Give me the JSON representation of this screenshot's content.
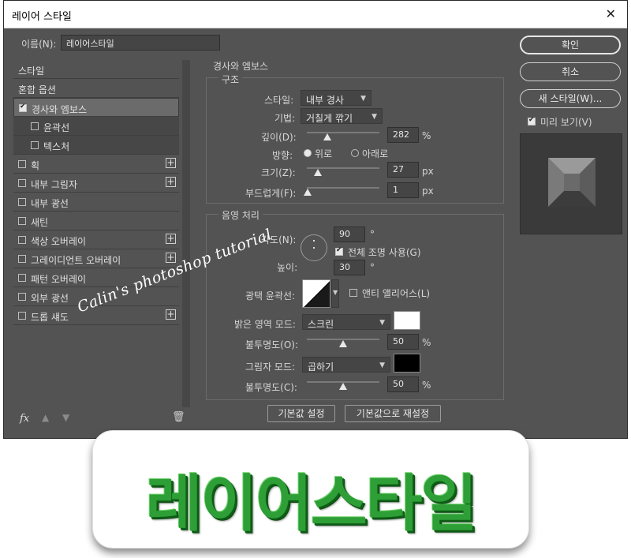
{
  "window": {
    "title": "레이어 스타일",
    "close_glyph": "✕"
  },
  "name_row": {
    "label": "이름(N):",
    "value": "레이어스타일"
  },
  "styles_list": {
    "items": [
      {
        "label": "스타일",
        "checkbox": false,
        "plus": false,
        "kind": "header"
      },
      {
        "label": "혼합 옵션",
        "checkbox": false,
        "plus": false,
        "kind": "header"
      },
      {
        "label": "경사와 엠보스",
        "checkbox": true,
        "checked": true,
        "plus": false,
        "kind": "selected"
      },
      {
        "label": "윤곽선",
        "checkbox": true,
        "checked": false,
        "plus": false,
        "kind": "sub"
      },
      {
        "label": "텍스처",
        "checkbox": true,
        "checked": false,
        "plus": false,
        "kind": "sub"
      },
      {
        "label": "획",
        "checkbox": true,
        "checked": false,
        "plus": true,
        "kind": "normal"
      },
      {
        "label": "내부 그림자",
        "checkbox": true,
        "checked": false,
        "plus": true,
        "kind": "normal"
      },
      {
        "label": "내부 광선",
        "checkbox": true,
        "checked": false,
        "plus": false,
        "kind": "normal"
      },
      {
        "label": "새틴",
        "checkbox": true,
        "checked": false,
        "plus": false,
        "kind": "normal"
      },
      {
        "label": "색상 오버레이",
        "checkbox": true,
        "checked": false,
        "plus": true,
        "kind": "normal"
      },
      {
        "label": "그레이디언트 오버레이",
        "checkbox": true,
        "checked": false,
        "plus": true,
        "kind": "normal"
      },
      {
        "label": "패턴 오버레이",
        "checkbox": true,
        "checked": false,
        "plus": false,
        "kind": "normal"
      },
      {
        "label": "외부 광선",
        "checkbox": true,
        "checked": false,
        "plus": false,
        "kind": "normal"
      },
      {
        "label": "드롭 섀도",
        "checkbox": true,
        "checked": false,
        "plus": true,
        "kind": "normal"
      }
    ],
    "footer": {
      "fx": "fx",
      "up_icon": "arrow-up-icon",
      "down_icon": "arrow-down-icon",
      "trash_icon": "trash-icon"
    }
  },
  "bevel": {
    "section_title": "경사와 엠보스",
    "structure_title": "구조",
    "style_label": "스타일:",
    "style_value": "내부 경사",
    "technique_label": "기법:",
    "technique_value": "거칠게 깎기",
    "depth_label": "깊이(D):",
    "depth_value": "282",
    "depth_unit": "%",
    "direction_label": "방향:",
    "dir_up": "위로",
    "dir_down": "아래로",
    "direction_selected": "위로",
    "size_label": "크기(Z):",
    "size_value": "27",
    "size_unit": "px",
    "soften_label": "부드럽게(F):",
    "soften_value": "1",
    "soften_unit": "px",
    "slider_levels": {
      "depth": 0.28,
      "size": 0.15,
      "soften": 0.01
    }
  },
  "shading": {
    "title": "음영 처리",
    "angle_label": "각도(N):",
    "angle_value": "90",
    "angle_unit": "°",
    "global_light_label": "전체 조명 사용(G)",
    "global_light_checked": true,
    "altitude_label": "높이:",
    "altitude_value": "30",
    "altitude_unit": "°",
    "gloss_label": "광택 윤곽선:",
    "antialias_label": "앤티 앨리어스(L)",
    "antialias_checked": false,
    "highlight_mode_label": "밝은 영역 모드:",
    "highlight_mode_value": "스크린",
    "highlight_color": "#ffffff",
    "highlight_opacity_label": "불투명도(O):",
    "highlight_opacity_value": "50",
    "highlight_opacity_unit": "%",
    "shadow_mode_label": "그림자 모드:",
    "shadow_mode_value": "곱하기",
    "shadow_color": "#000000",
    "shadow_opacity_label": "불투명도(C):",
    "shadow_opacity_value": "50",
    "shadow_opacity_unit": "%",
    "slider_levels": {
      "highlight_opacity": 0.5,
      "shadow_opacity": 0.5
    }
  },
  "bottom_buttons": {
    "make_default": "기본값 설정",
    "reset_default": "기본값으로 재설정"
  },
  "right_panel": {
    "ok": "확인",
    "cancel": "취소",
    "new_style": "새 스타일(W)...",
    "preview_label": "미리 보기(V)",
    "preview_checked": true
  },
  "watermark": "Calin's photoshop tutorial",
  "banner_text": "레이어스타일",
  "colors": {
    "dialog_bg": "#535353",
    "banner_green": "#2e9e36"
  }
}
